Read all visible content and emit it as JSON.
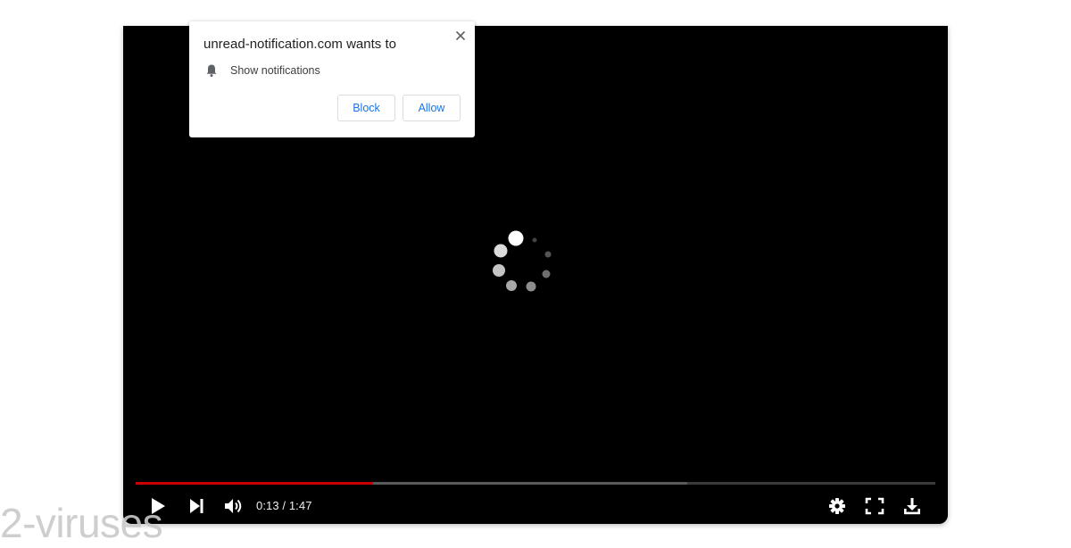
{
  "popup": {
    "title": "unread-notification.com wants to",
    "permission_label": "Show notifications",
    "block_label": "Block",
    "allow_label": "Allow"
  },
  "player": {
    "time_display": "0:13 / 1:47",
    "progress_fraction": 0.297,
    "buffered_fraction": 0.69,
    "loading": true,
    "colors": {
      "progress": "#cc0000",
      "background": "#000000"
    }
  },
  "controls": {
    "icons": [
      "play-icon",
      "next-icon",
      "volume-icon",
      "settings-icon",
      "fullscreen-icon",
      "download-icon"
    ]
  },
  "watermark": {
    "text": "2-viruses"
  }
}
